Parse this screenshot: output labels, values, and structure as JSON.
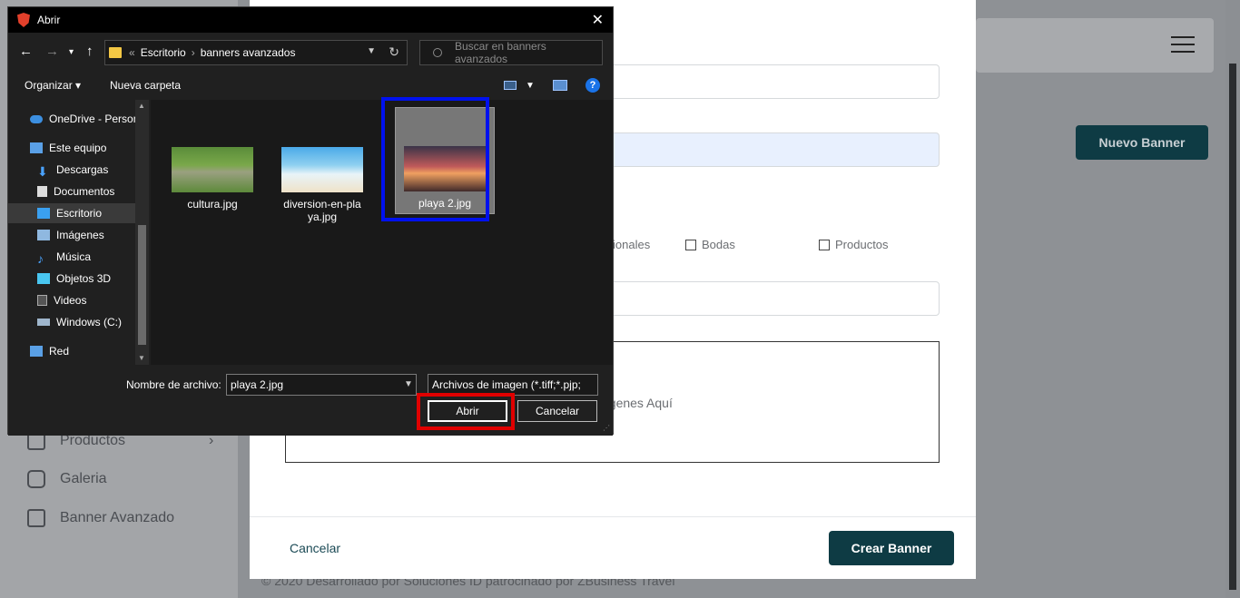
{
  "background_app": {
    "new_banner_button": "Nuevo Banner",
    "sidebar": [
      {
        "label": "Productos",
        "icon": "bag-icon"
      },
      {
        "label": "Galeria",
        "icon": "camera-icon"
      },
      {
        "label": "Banner Avanzado",
        "icon": "image-icon"
      }
    ],
    "footer": "© 2020 Desarrollado por Soluciones ID patrocinado por ZBusiness Travel",
    "modal": {
      "checkbox_partial": "ionales",
      "checkbox_bodas": "Bodas",
      "checkbox_productos": "Productos",
      "dropzone_text": "agenes Aquí",
      "cancel": "Cancelar",
      "create": "Crear Banner"
    }
  },
  "dialog": {
    "title": "Abrir",
    "breadcrumb": [
      "Escritorio",
      "banners avanzados"
    ],
    "search_placeholder": "Buscar en banners avanzados",
    "toolbar": {
      "organize": "Organizar",
      "new_folder": "Nueva carpeta"
    },
    "nav_items": [
      {
        "label": "OneDrive - Person",
        "icon": "cloud-icon"
      },
      {
        "label": "Este equipo",
        "icon": "computer-icon"
      },
      {
        "label": "Descargas",
        "icon": "download-icon"
      },
      {
        "label": "Documentos",
        "icon": "document-icon"
      },
      {
        "label": "Escritorio",
        "icon": "desktop-icon",
        "selected": true
      },
      {
        "label": "Imágenes",
        "icon": "pictures-icon"
      },
      {
        "label": "Música",
        "icon": "music-icon"
      },
      {
        "label": "Objetos 3D",
        "icon": "cube-icon"
      },
      {
        "label": "Videos",
        "icon": "video-icon"
      },
      {
        "label": "Windows (C:)",
        "icon": "drive-icon"
      },
      {
        "label": "Red",
        "icon": "network-icon"
      }
    ],
    "files": [
      {
        "name": "cultura.jpg"
      },
      {
        "name": "diversion-en-playa.jpg",
        "line1": "diversion-en-pla",
        "line2": "ya.jpg"
      },
      {
        "name": "playa 2.jpg",
        "selected": true
      }
    ],
    "filename_label": "Nombre de archivo:",
    "filename_value": "playa 2.jpg",
    "filter": "Archivos de imagen (*.tiff;*.pjp;",
    "open_button": "Abrir",
    "cancel_button": "Cancelar",
    "colors": {
      "highlight_selected_file": "#0011ee",
      "highlight_open_button": "#e00000"
    }
  }
}
